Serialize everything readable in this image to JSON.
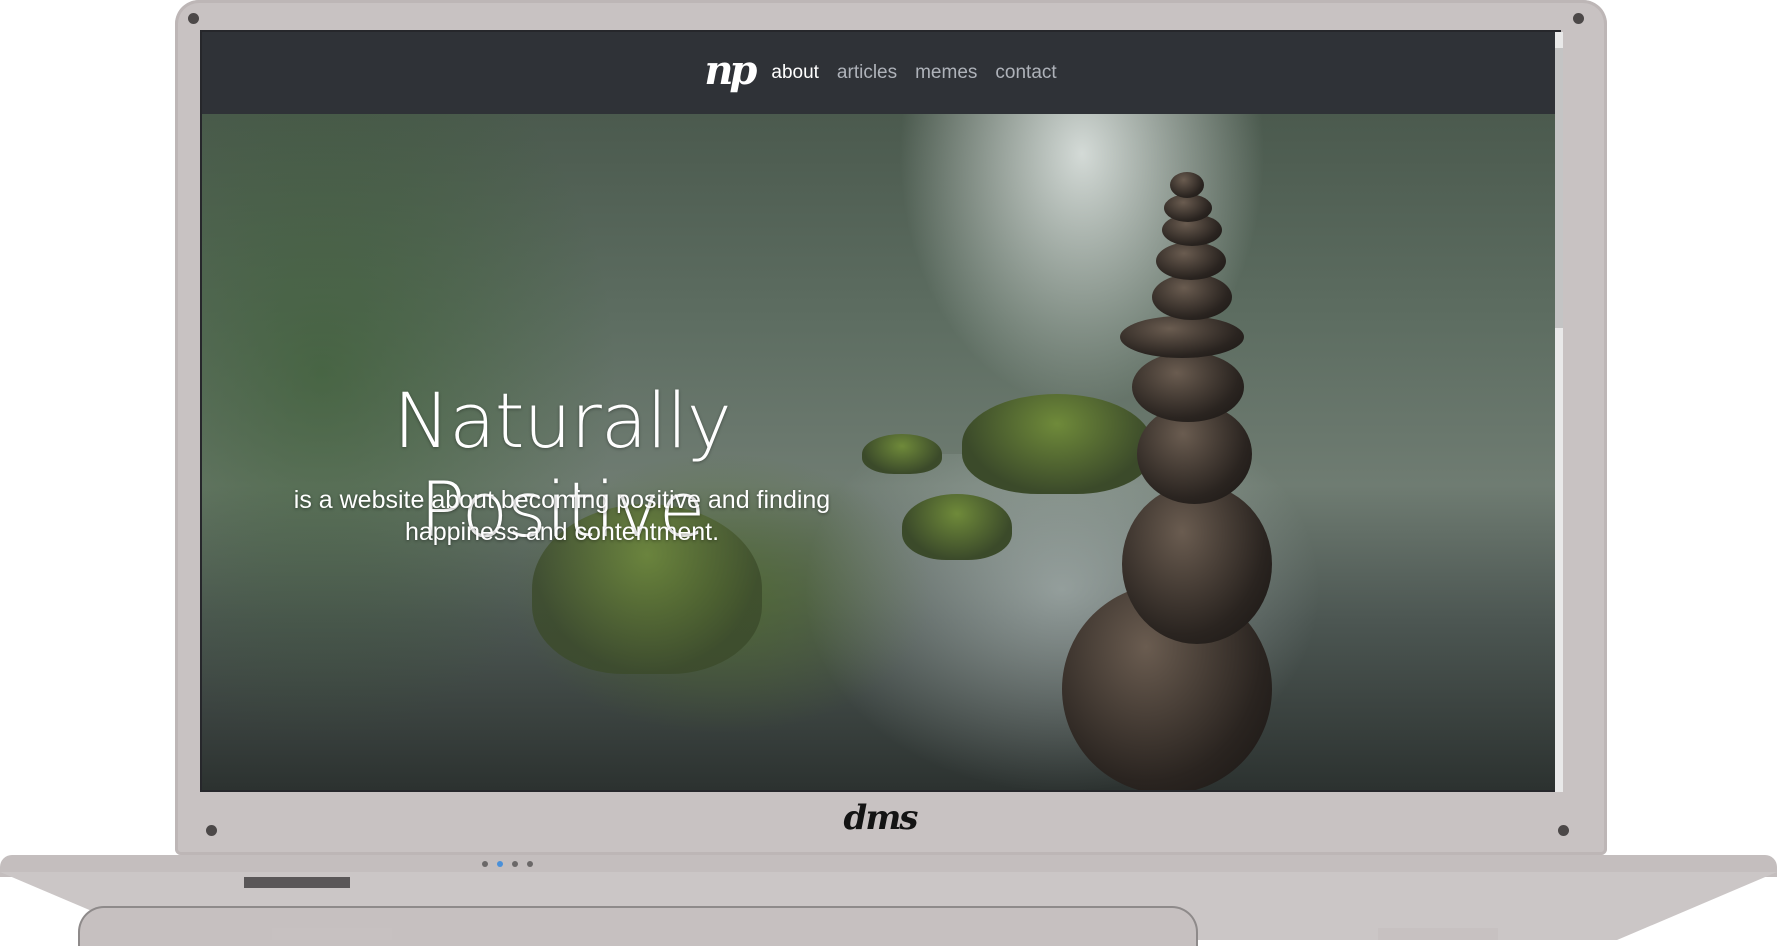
{
  "site": {
    "logo_text": "np",
    "nav": [
      {
        "label": "about",
        "active": true
      },
      {
        "label": "articles",
        "active": false
      },
      {
        "label": "memes",
        "active": false
      },
      {
        "label": "contact",
        "active": false
      }
    ],
    "hero": {
      "title": "Naturally Positive",
      "subtitle_line1": "is a website about becoming positive and finding",
      "subtitle_line2": "happiness and contentment."
    }
  },
  "device": {
    "brand": "dms",
    "carousel_dots": 4,
    "carousel_active_index": 1
  },
  "colors": {
    "navbar": "#2f3237",
    "nav_inactive": "#aeb2b9",
    "nav_active": "#ffffff",
    "laptop_body": "#c8c2c2",
    "carousel_active": "#4a90d9"
  }
}
